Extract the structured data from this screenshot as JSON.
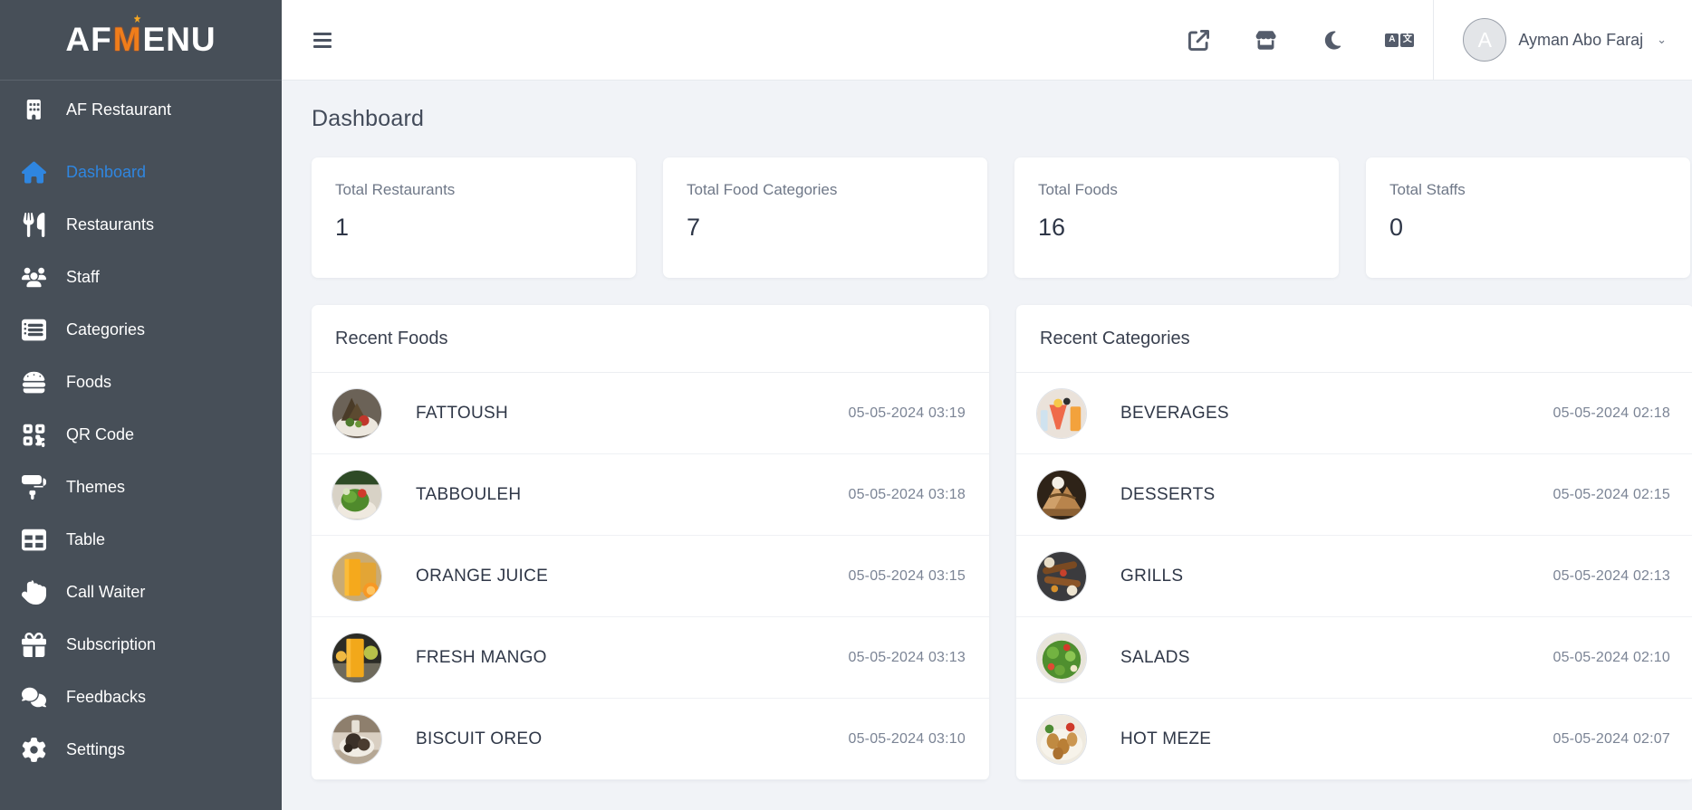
{
  "brand": {
    "logo_part1": "AF",
    "logo_m": "M",
    "logo_part2": "ENU"
  },
  "sidebar": {
    "restaurant": {
      "label": "AF Restaurant",
      "icon": "building-icon"
    },
    "items": [
      {
        "label": "Dashboard",
        "icon": "home-icon",
        "active": true
      },
      {
        "label": "Restaurants",
        "icon": "utensils-icon",
        "active": false
      },
      {
        "label": "Staff",
        "icon": "users-icon",
        "active": false
      },
      {
        "label": "Categories",
        "icon": "list-icon",
        "active": false
      },
      {
        "label": "Foods",
        "icon": "burger-icon",
        "active": false
      },
      {
        "label": "QR Code",
        "icon": "qrcode-icon",
        "active": false
      },
      {
        "label": "Themes",
        "icon": "paint-roller-icon",
        "active": false
      },
      {
        "label": "Table",
        "icon": "table-icon",
        "active": false
      },
      {
        "label": "Call Waiter",
        "icon": "hand-icon",
        "active": false
      },
      {
        "label": "Subscription",
        "icon": "gift-icon",
        "active": false
      },
      {
        "label": "Feedbacks",
        "icon": "comments-icon",
        "active": false
      },
      {
        "label": "Settings",
        "icon": "gear-icon",
        "active": false
      }
    ]
  },
  "topbar": {
    "menu_toggle": "hamburger-icon",
    "icons": [
      {
        "name": "external-link-icon"
      },
      {
        "name": "store-icon"
      },
      {
        "name": "moon-icon"
      }
    ],
    "language": {
      "name": "translate-icon",
      "left": "A",
      "right": "文"
    },
    "user": {
      "initial": "A",
      "name": "Ayman Abo Faraj",
      "caret": "⌄"
    }
  },
  "page": {
    "title": "Dashboard"
  },
  "stats": [
    {
      "label": "Total Restaurants",
      "value": "1"
    },
    {
      "label": "Total Food Categories",
      "value": "7"
    },
    {
      "label": "Total Foods",
      "value": "16"
    },
    {
      "label": "Total Staffs",
      "value": "0"
    }
  ],
  "recent_foods": {
    "title": "Recent Foods",
    "rows": [
      {
        "name": "FATTOUSH",
        "date": "05-05-2024 03:19",
        "img": "salad-fattoush"
      },
      {
        "name": "TABBOULEH",
        "date": "05-05-2024 03:18",
        "img": "salad-tabbouleh"
      },
      {
        "name": "ORANGE JUICE",
        "date": "05-05-2024 03:15",
        "img": "orange-juice"
      },
      {
        "name": "FRESH MANGO",
        "date": "05-05-2024 03:13",
        "img": "mango-juice"
      },
      {
        "name": "BISCUIT OREO",
        "date": "05-05-2024 03:10",
        "img": "biscuit-oreo"
      }
    ]
  },
  "recent_categories": {
    "title": "Recent Categories",
    "rows": [
      {
        "name": "BEVERAGES",
        "date": "05-05-2024 02:18",
        "img": "beverages"
      },
      {
        "name": "DESSERTS",
        "date": "05-05-2024 02:15",
        "img": "desserts"
      },
      {
        "name": "GRILLS",
        "date": "05-05-2024 02:13",
        "img": "grills"
      },
      {
        "name": "SALADS",
        "date": "05-05-2024 02:10",
        "img": "salads"
      },
      {
        "name": "HOT MEZE",
        "date": "05-05-2024 02:07",
        "img": "hot-meze"
      }
    ]
  },
  "colors": {
    "sidebar_bg": "#474f58",
    "accent": "#2f86e0",
    "brand_orange": "#f07d1a",
    "page_bg": "#f1f3f7",
    "card_bg": "#ffffff"
  }
}
